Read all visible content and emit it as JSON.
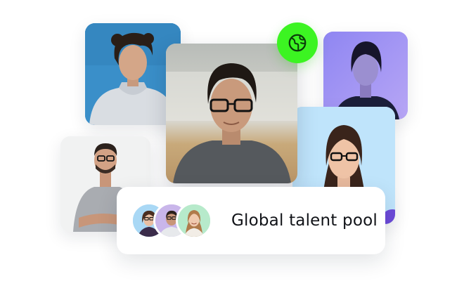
{
  "card": {
    "label": "Global talent pool"
  },
  "badge": {
    "icon": "globe-icon",
    "color": "#3cf422"
  },
  "photos": [
    {
      "name": "photo-young-man-curly-hair",
      "background": "#3a8fc9"
    },
    {
      "name": "photo-man-glasses-center",
      "background": "#c4c6c0"
    },
    {
      "name": "photo-woman-purple-light",
      "background": "#9b8ef0"
    },
    {
      "name": "photo-girl-glasses",
      "background": "#bfe4fb"
    },
    {
      "name": "photo-man-crossed-arms",
      "background": "#f1f2f2"
    }
  ],
  "avatars": [
    {
      "name": "avatar-woman-glasses",
      "background": "#a9d8f5"
    },
    {
      "name": "avatar-man-glasses",
      "background": "#c9b6ea"
    },
    {
      "name": "avatar-woman-smiling",
      "background": "#b7eacb"
    }
  ]
}
